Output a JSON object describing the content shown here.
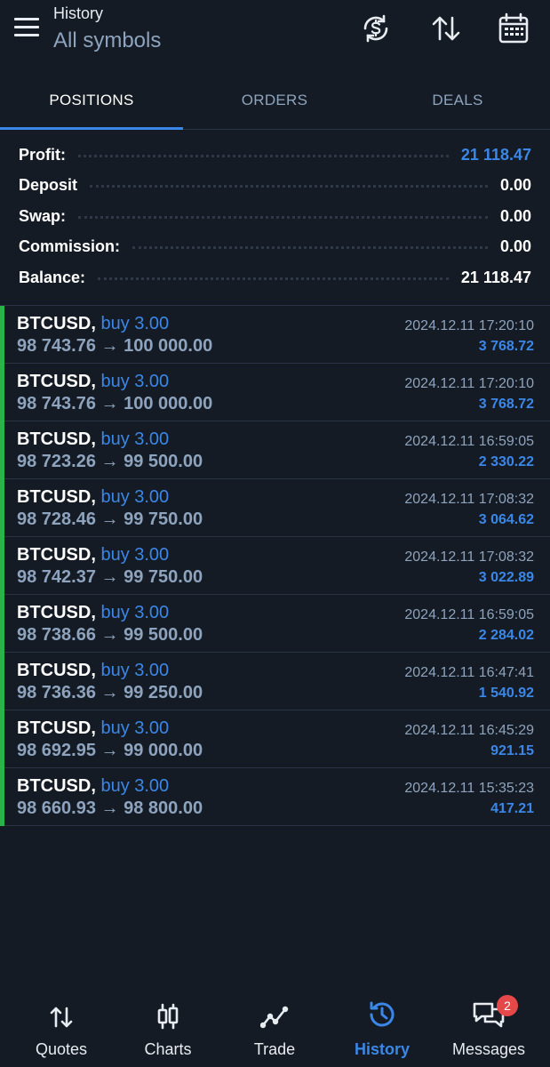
{
  "header": {
    "title": "History",
    "subtitle": "All symbols",
    "icons": [
      "currency-exchange-icon",
      "sort-icon",
      "calendar-icon"
    ]
  },
  "tabs": [
    {
      "label": "POSITIONS",
      "active": true
    },
    {
      "label": "ORDERS",
      "active": false
    },
    {
      "label": "DEALS",
      "active": false
    }
  ],
  "summary": [
    {
      "label": "Profit:",
      "value": "21 118.47",
      "highlight": true
    },
    {
      "label": "Deposit",
      "value": "0.00",
      "highlight": false
    },
    {
      "label": "Swap:",
      "value": "0.00",
      "highlight": false
    },
    {
      "label": "Commission:",
      "value": "0.00",
      "highlight": false
    },
    {
      "label": "Balance:",
      "value": "21 118.47",
      "highlight": false
    }
  ],
  "positions": [
    {
      "symbol": "BTCUSD,",
      "side": " buy 3.00",
      "prices": "98 743.76 → 100 000.00",
      "time": "2024.12.11 17:20:10",
      "profit": "3 768.72"
    },
    {
      "symbol": "BTCUSD,",
      "side": " buy 3.00",
      "prices": "98 743.76 → 100 000.00",
      "time": "2024.12.11 17:20:10",
      "profit": "3 768.72"
    },
    {
      "symbol": "BTCUSD,",
      "side": " buy 3.00",
      "prices": "98 723.26 → 99 500.00",
      "time": "2024.12.11 16:59:05",
      "profit": "2 330.22"
    },
    {
      "symbol": "BTCUSD,",
      "side": " buy 3.00",
      "prices": "98 728.46 → 99 750.00",
      "time": "2024.12.11 17:08:32",
      "profit": "3 064.62"
    },
    {
      "symbol": "BTCUSD,",
      "side": " buy 3.00",
      "prices": "98 742.37 → 99 750.00",
      "time": "2024.12.11 17:08:32",
      "profit": "3 022.89"
    },
    {
      "symbol": "BTCUSD,",
      "side": " buy 3.00",
      "prices": "98 738.66 → 99 500.00",
      "time": "2024.12.11 16:59:05",
      "profit": "2 284.02"
    },
    {
      "symbol": "BTCUSD,",
      "side": " buy 3.00",
      "prices": "98 736.36 → 99 250.00",
      "time": "2024.12.11 16:47:41",
      "profit": "1 540.92"
    },
    {
      "symbol": "BTCUSD,",
      "side": " buy 3.00",
      "prices": "98 692.95 → 99 000.00",
      "time": "2024.12.11 16:45:29",
      "profit": "921.15"
    },
    {
      "symbol": "BTCUSD,",
      "side": " buy 3.00",
      "prices": "98 660.93 → 98 800.00",
      "time": "2024.12.11 15:35:23",
      "profit": "417.21"
    }
  ],
  "nav": [
    {
      "label": "Quotes",
      "icon": "quotes-arrows-icon",
      "active": false
    },
    {
      "label": "Charts",
      "icon": "candlestick-chart-icon",
      "active": false
    },
    {
      "label": "Trade",
      "icon": "trade-line-icon",
      "active": false
    },
    {
      "label": "History",
      "icon": "history-clock-icon",
      "active": true
    },
    {
      "label": "Messages",
      "icon": "chat-bubbles-icon",
      "active": false,
      "badge": "2"
    }
  ],
  "colors": {
    "background": "#141b24",
    "accent": "#3b87e8",
    "muted": "#8ea3bd",
    "profit_bar": "#29b34a",
    "badge": "#e54848"
  }
}
